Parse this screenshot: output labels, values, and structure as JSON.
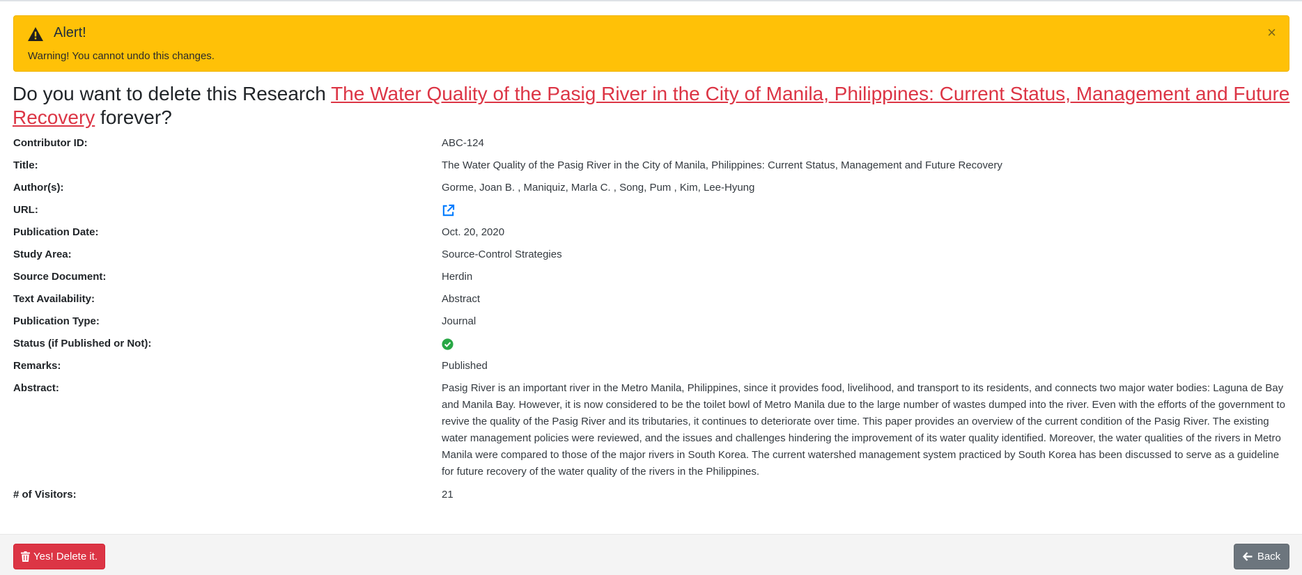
{
  "alert": {
    "title": "Alert!",
    "message": "Warning! You cannot undo this changes.",
    "close_symbol": "×",
    "icon": "warning-triangle-icon"
  },
  "heading": {
    "prefix": "Do you want to delete this Research ",
    "research_link": "The Water Quality of the Pasig River in the City of Manila, Philippines: Current Status, Management and Future Recovery",
    "suffix": " forever?"
  },
  "details": {
    "contributor_id": {
      "label": "Contributor ID:",
      "value": "ABC-124"
    },
    "title": {
      "label": "Title:",
      "value": "The Water Quality of the Pasig River in the City of Manila, Philippines: Current Status, Management and Future Recovery"
    },
    "authors": {
      "label": "Author(s):",
      "value": "Gorme, Joan B. , Maniquiz, Marla C. , Song, Pum , Kim, Lee-Hyung"
    },
    "url": {
      "label": "URL:",
      "icon": "external-link-icon"
    },
    "publication_date": {
      "label": "Publication Date:",
      "value": "Oct. 20, 2020"
    },
    "study_area": {
      "label": "Study Area:",
      "value": "Source-Control Strategies"
    },
    "source_document": {
      "label": "Source Document:",
      "value": "Herdin"
    },
    "text_availability": {
      "label": "Text Availability:",
      "value": "Abstract"
    },
    "publication_type": {
      "label": "Publication Type:",
      "value": "Journal"
    },
    "status": {
      "label": "Status (if Published or Not):",
      "icon": "check-circle-icon"
    },
    "remarks": {
      "label": "Remarks:",
      "value": "Published"
    },
    "abstract": {
      "label": "Abstract:",
      "value": "Pasig River is an important river in the Metro Manila, Philippines, since it provides food, livelihood, and transport to its residents, and connects two major water bodies: Laguna de Bay and Manila Bay. However, it is now considered to be the toilet bowl of Metro Manila due to the large number of wastes dumped into the river. Even with the efforts of the government to revive the quality of the Pasig River and its tributaries, it continues to deteriorate over time. This paper provides an overview of the current condition of the Pasig River. The existing water management policies were reviewed, and the issues and challenges hindering the improvement of its water quality identified. Moreover, the water qualities of the rivers in Metro Manila were compared to those of the major rivers in South Korea. The current watershed management system practiced by South Korea has been discussed to serve as a guideline for future recovery of the water quality of the rivers in the Philippines."
    },
    "visitors": {
      "label": "# of Visitors:",
      "value": "21"
    }
  },
  "footer": {
    "delete_label": "Yes! Delete it.",
    "back_label": "Back"
  },
  "colors": {
    "alert_bg": "#ffc107",
    "danger": "#dc3545",
    "secondary": "#6c757d",
    "link_blue": "#007bff",
    "success": "#28a745"
  }
}
